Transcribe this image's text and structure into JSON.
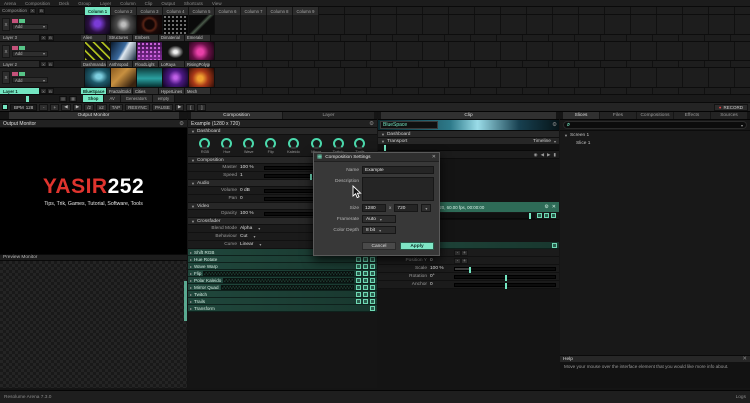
{
  "menu": {
    "items": [
      "Arena",
      "Composition",
      "Deck",
      "Group",
      "Layer",
      "Column",
      "Clip",
      "Output",
      "Shortcuts",
      "View"
    ]
  },
  "grid": {
    "corner": "Composition",
    "btn_x": "X",
    "btn_b": "B",
    "columns": [
      "Column 1",
      "Column 2",
      "Column 3",
      "Column 4",
      "Column 5",
      "Column 6",
      "Column 7",
      "Column 8",
      "Column 9"
    ],
    "layers": [
      {
        "name": "Layer 3",
        "blend": "Add",
        "clips": [
          "Alien",
          "Structures",
          "Embers",
          "Dimaterial",
          "Emerald"
        ]
      },
      {
        "name": "Layer 2",
        "blend": "Add",
        "clips": [
          "Dashmandala",
          "Anthropod",
          "FloodLight",
          "LoRaya",
          "RisingPolygons"
        ]
      },
      {
        "name": "Layer 1",
        "blend": "Add",
        "clips": [
          "BlueSpace",
          "FractalGold",
          "Cities",
          "HyperLines",
          "Mech"
        ]
      }
    ],
    "deck_tabs": [
      "Shop",
      "AV",
      "Generators",
      "empty"
    ]
  },
  "transport": {
    "bpm_label": "BPM",
    "bpm_value": "128",
    "nudge_down": "-",
    "nudge_up": "+",
    "prev": "◀",
    "next": "▶",
    "div2": "/2",
    "mul2": "x2",
    "tap": "TAP",
    "resync": "RESYNC",
    "pause": "PAUSE",
    "record": "RECORD"
  },
  "monitors": {
    "output_tab": "Output Monitor",
    "output_header": "Output Monitor",
    "preview_header": "Preview Monitor",
    "logo_red": "YASIR",
    "logo_white": "252",
    "logo_sub": "Tips, Trik, Games, Tutorial,  Software, Tools"
  },
  "composition": {
    "tab_composition": "Composition",
    "tab_layer": "Layer",
    "title": "Example (1280 x 720)",
    "dashboard_label": "Dashboard",
    "knobs": [
      "RGB",
      "Hue",
      "Wave",
      "Flip",
      "Kaleido",
      "Mirror",
      "Twitch",
      "Trails"
    ],
    "section_label": "Composition",
    "master_label": "Master",
    "master_value": "100 %",
    "speed_label": "Speed",
    "speed_value": "1",
    "audio_label": "Audio",
    "volume_label": "Volume",
    "volume_value": "0 dB",
    "pan_label": "Pan",
    "pan_value": "0",
    "video_label": "Video",
    "opacity_label": "Opacity",
    "opacity_value": "100 %",
    "crossfader_label": "Crossfader",
    "blend_label": "Blend Mode",
    "blend_value": "Alpha",
    "behaviour_label": "Behaviour",
    "behaviour_value": "Cut",
    "curve_label": "Curve",
    "curve_value": "Linear",
    "effects": [
      "Shift RGB",
      "Hue Rotate",
      "Wave Warp",
      "Flip",
      "Polar Kaleido",
      "Mirror Quad",
      "Twitch",
      "Trails",
      "Transform"
    ]
  },
  "clip": {
    "tab": "Clip",
    "name": "BlueSpace",
    "dashboard_label": "Dashboard",
    "transport_label": "Transport",
    "timeline_value": "Timeline",
    "info": "BlueSpace, No Alpha, 1280x720, 60.00 fps, 00:00:00",
    "transform_label": "Transform",
    "posx_label": "Position X",
    "posx_value": "0",
    "posy_label": "Position Y",
    "posy_value": "0",
    "scale_label": "Scale",
    "scale_value": "100 %",
    "rotation_label": "Rotation",
    "rotation_value": "0°",
    "anchor_label": "Anchor",
    "anchor_value": "0"
  },
  "browser": {
    "tabs": [
      "Slices",
      "Files",
      "Compositions",
      "Effects",
      "Sources"
    ],
    "screen": "Screen 1",
    "slice": "Slice 1"
  },
  "help": {
    "title": "Help",
    "body": "Move your mouse over the interface element that you would like more info about."
  },
  "dialog": {
    "title": "Composition Settings",
    "name_label": "Name",
    "name_value": "Example",
    "description_label": "Description",
    "size_label": "Size",
    "size_width": "1280",
    "size_times": "x",
    "size_height": "720",
    "framerate_label": "Framerate",
    "framerate_value": "Auto",
    "colordepth_label": "Color Depth",
    "colordepth_value": "8 bit",
    "cancel": "Cancel",
    "apply": "Apply"
  },
  "status": {
    "left": "Resolume Arena 7.3.0",
    "right": "Logs"
  },
  "icons": {
    "gear": "⚙",
    "close": "✕",
    "caret_down": "▾",
    "caret_right": "▸",
    "tri_down": "▼",
    "record_dot": "●",
    "search": "⌕",
    "play": "▶",
    "prev": "◀",
    "stop": "▮",
    "loop": "◉",
    "list": "▤",
    "grid_view": "▦",
    "minus": "-",
    "plus": "+",
    "grid_glyph": "▦"
  },
  "colors": {
    "accent": "#74e6c2",
    "record_red": "#e04545",
    "logo_red": "#e0342e"
  }
}
